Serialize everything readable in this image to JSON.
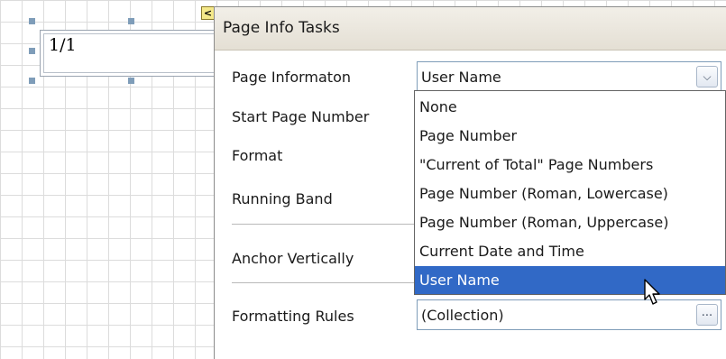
{
  "surface": {
    "control_text": "1/1",
    "smart_tag_glyph": "<"
  },
  "panel": {
    "title": "Page Info Tasks",
    "labels": {
      "page_information": "Page Informaton",
      "start_page_number": "Start Page Number",
      "format": "Format",
      "running_band": "Running Band",
      "anchor_vertically": "Anchor Vertically",
      "formatting_rules": "Formatting Rules"
    },
    "page_information_value": "User Name",
    "formatting_rules_value": "(Collection)",
    "ellipsis": "..."
  },
  "dropdown": {
    "options": [
      "None",
      "Page Number",
      "\"Current of Total\" Page Numbers",
      "Page Number (Roman, Lowercase)",
      "Page Number (Roman, Uppercase)",
      "Current Date and Time",
      "User Name"
    ],
    "selected": "User Name"
  },
  "colors": {
    "selection": "#3169c6",
    "title_bar": "#ece9e0",
    "handle": "#7f9db9",
    "smart_tag": "#f5e98a"
  }
}
